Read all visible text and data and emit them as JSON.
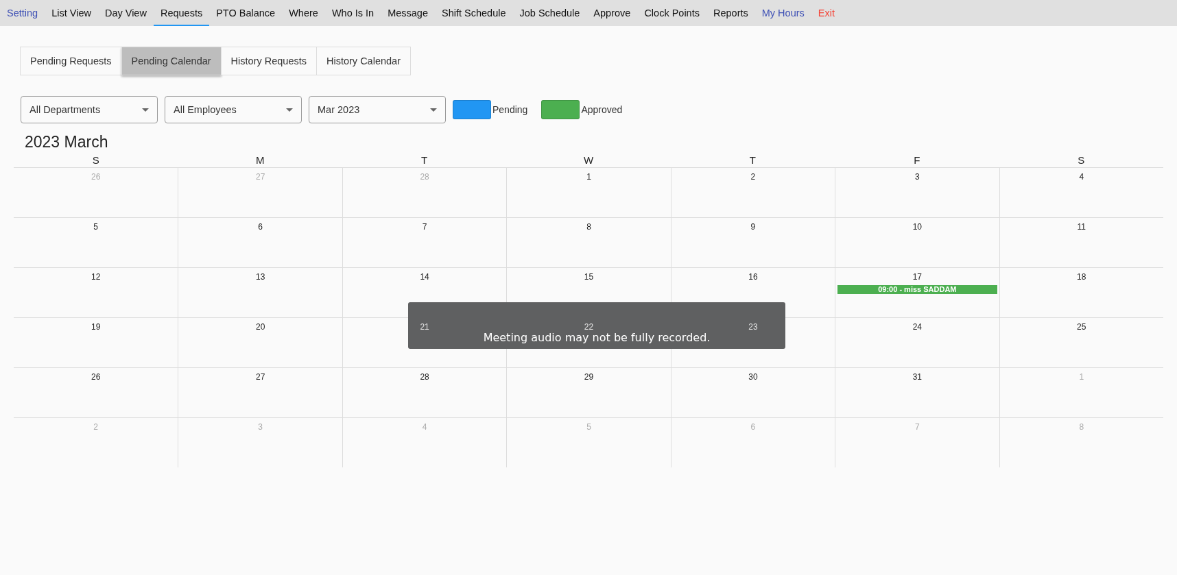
{
  "nav": [
    {
      "label": "Setting",
      "kind": "accent",
      "selected": false
    },
    {
      "label": "List View",
      "kind": "plain",
      "selected": false
    },
    {
      "label": "Day View",
      "kind": "plain",
      "selected": false
    },
    {
      "label": "Requests",
      "kind": "plain",
      "selected": true
    },
    {
      "label": "PTO Balance",
      "kind": "plain",
      "selected": false
    },
    {
      "label": "Where",
      "kind": "plain",
      "selected": false
    },
    {
      "label": "Who Is In",
      "kind": "plain",
      "selected": false
    },
    {
      "label": "Message",
      "kind": "plain",
      "selected": false
    },
    {
      "label": "Shift Schedule",
      "kind": "plain",
      "selected": false
    },
    {
      "label": "Job Schedule",
      "kind": "plain",
      "selected": false
    },
    {
      "label": "Approve",
      "kind": "plain",
      "selected": false
    },
    {
      "label": "Clock Points",
      "kind": "plain",
      "selected": false
    },
    {
      "label": "Reports",
      "kind": "plain",
      "selected": false
    },
    {
      "label": "My Hours",
      "kind": "accent",
      "selected": false
    },
    {
      "label": "Exit",
      "kind": "danger",
      "selected": false
    }
  ],
  "tabs": [
    {
      "label": "Pending Requests",
      "selected": false
    },
    {
      "label": "Pending Calendar",
      "selected": true
    },
    {
      "label": "History Requests",
      "selected": false
    },
    {
      "label": "History Calendar",
      "selected": false
    }
  ],
  "filters": [
    {
      "value": "All Departments"
    },
    {
      "value": "All Employees"
    },
    {
      "value": "Mar 2023"
    }
  ],
  "legend": [
    {
      "label": "Pending",
      "color": "#2196f3"
    },
    {
      "label": "Approved",
      "color": "#4caf50"
    }
  ],
  "calendar": {
    "title": "2023 March",
    "weekdays": [
      "S",
      "M",
      "T",
      "W",
      "T",
      "F",
      "S"
    ],
    "weeks": [
      [
        {
          "day": "26",
          "muted": true
        },
        {
          "day": "27",
          "muted": true
        },
        {
          "day": "28",
          "muted": true
        },
        {
          "day": "1",
          "muted": false
        },
        {
          "day": "2",
          "muted": false
        },
        {
          "day": "3",
          "muted": false
        },
        {
          "day": "4",
          "muted": false
        }
      ],
      [
        {
          "day": "5",
          "muted": false
        },
        {
          "day": "6",
          "muted": false
        },
        {
          "day": "7",
          "muted": false
        },
        {
          "day": "8",
          "muted": false
        },
        {
          "day": "9",
          "muted": false
        },
        {
          "day": "10",
          "muted": false
        },
        {
          "day": "11",
          "muted": false
        }
      ],
      [
        {
          "day": "12",
          "muted": false
        },
        {
          "day": "13",
          "muted": false
        },
        {
          "day": "14",
          "muted": false
        },
        {
          "day": "15",
          "muted": false
        },
        {
          "day": "16",
          "muted": false
        },
        {
          "day": "17",
          "muted": false,
          "events": [
            {
              "text": "09:00 - miss SADDAM",
              "color": "#4caf50"
            }
          ]
        },
        {
          "day": "18",
          "muted": false
        }
      ],
      [
        {
          "day": "19",
          "muted": false
        },
        {
          "day": "20",
          "muted": false
        },
        {
          "day": "21",
          "muted": false,
          "under_toast": true
        },
        {
          "day": "22",
          "muted": false,
          "under_toast": true
        },
        {
          "day": "23",
          "muted": false,
          "under_toast": true
        },
        {
          "day": "24",
          "muted": false
        },
        {
          "day": "25",
          "muted": false
        }
      ],
      [
        {
          "day": "26",
          "muted": false
        },
        {
          "day": "27",
          "muted": false
        },
        {
          "day": "28",
          "muted": false
        },
        {
          "day": "29",
          "muted": false
        },
        {
          "day": "30",
          "muted": false
        },
        {
          "day": "31",
          "muted": false
        },
        {
          "day": "1",
          "muted": true
        }
      ],
      [
        {
          "day": "2",
          "muted": true
        },
        {
          "day": "3",
          "muted": true
        },
        {
          "day": "4",
          "muted": true
        },
        {
          "day": "5",
          "muted": true
        },
        {
          "day": "6",
          "muted": true
        },
        {
          "day": "7",
          "muted": true
        },
        {
          "day": "8",
          "muted": true
        }
      ]
    ]
  },
  "toast": {
    "message": "Meeting audio may not be fully recorded."
  }
}
